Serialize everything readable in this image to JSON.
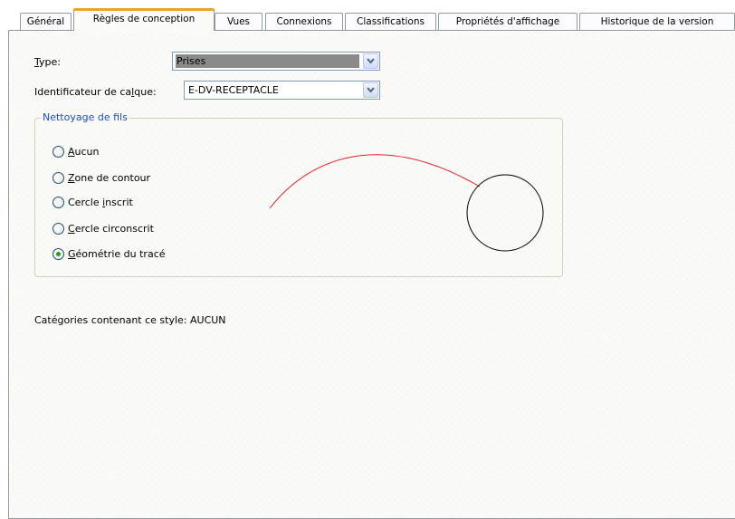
{
  "tabs": [
    {
      "label": "Général",
      "active": false
    },
    {
      "label": "Règles de conception",
      "active": true
    },
    {
      "label": "Vues",
      "active": false
    },
    {
      "label": "Connexions",
      "active": false
    },
    {
      "label": "Classifications",
      "active": false
    },
    {
      "label": "Propriétés d'affichage",
      "active": false
    },
    {
      "label": "Historique de la version",
      "active": false
    }
  ],
  "type_field": {
    "label_pre": "",
    "label_u": "T",
    "label_post": "ype:",
    "value": "Prises"
  },
  "layer_field": {
    "label_pre": "Identificateur de ca",
    "label_u": "l",
    "label_post": "que:",
    "value": "E-DV-RECEPTACLE"
  },
  "wire_cleanup": {
    "title": "Nettoyage de fils",
    "options": [
      {
        "pre": "",
        "u": "A",
        "post": "ucun",
        "checked": false
      },
      {
        "pre": "",
        "u": "Z",
        "post": "one de contour",
        "checked": false
      },
      {
        "pre": "Cercle ",
        "u": "i",
        "post": "nscrit",
        "checked": false
      },
      {
        "pre": "",
        "u": "C",
        "post": "ercle circonscrit",
        "checked": false
      },
      {
        "pre": "",
        "u": "G",
        "post": "éométrie du tracé",
        "checked": true
      }
    ]
  },
  "categories_text": "Catégories contenant ce style: AUCUN",
  "colors": {
    "accent_tab": "#e8a527",
    "group_title": "#1b4bd1",
    "wire": "#e81e2a",
    "radio_dot": "#21a121"
  }
}
